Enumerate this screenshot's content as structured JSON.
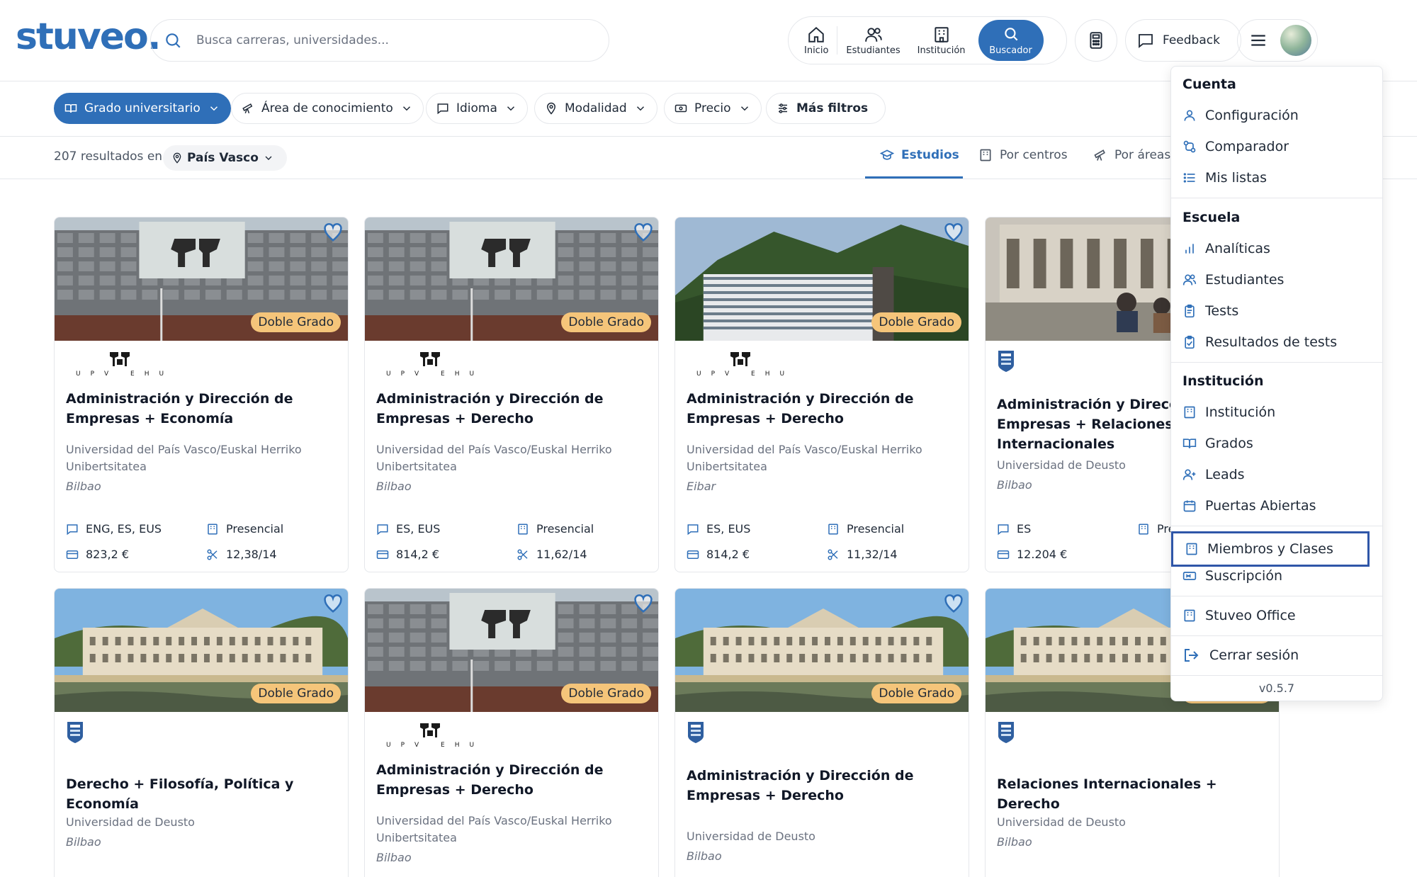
{
  "header": {
    "logo": "stuveo.",
    "search_placeholder": "Busca carreras, universidades...",
    "nav": [
      {
        "label": "Inicio",
        "icon": "home-icon"
      },
      {
        "label": "Estudiantes",
        "icon": "users-icon"
      },
      {
        "label": "Institución",
        "icon": "building-icon"
      },
      {
        "label": "Buscador",
        "icon": "search-icon"
      }
    ],
    "feedback_label": "Feedback"
  },
  "filters": [
    {
      "label": "Grado universitario"
    },
    {
      "label": "Área de conocimiento"
    },
    {
      "label": "Idioma"
    },
    {
      "label": "Modalidad"
    },
    {
      "label": "Precio"
    },
    {
      "label": "Más filtros"
    }
  ],
  "results": {
    "count_text": "207 resultados en",
    "region": "País Vasco",
    "tabs": [
      "Estudios",
      "Por centros",
      "Por áreas"
    ]
  },
  "badge_text": "Doble Grado",
  "cards": [
    {
      "title": "Administración y Dirección de Empresas + Economía",
      "university": "Universidad del País Vasco/Euskal Herriko Unibertsitatea",
      "city": "Bilbao",
      "languages": "ENG, ES, EUS",
      "mode": "Presencial",
      "price": "823,2 €",
      "grade": "12,38/14",
      "logo": "UPV EHU"
    },
    {
      "title": "Administración y Dirección de Empresas + Derecho",
      "university": "Universidad del País Vasco/Euskal Herriko Unibertsitatea",
      "city": "Bilbao",
      "languages": "ES, EUS",
      "mode": "Presencial",
      "price": "814,2 €",
      "grade": "11,62/14",
      "logo": "UPV EHU"
    },
    {
      "title": "Administración y Dirección de Empresas + Derecho",
      "university": "Universidad del País Vasco/Euskal Herriko Unibertsitatea",
      "city": "Eibar",
      "languages": "ES, EUS",
      "mode": "Presencial",
      "price": "814,2 €",
      "grade": "11,32/14",
      "logo": "UPV EHU"
    },
    {
      "title": "Administración y Dirección de Empresas + Relaciones Internacionales",
      "university": "Universidad de Deusto",
      "city": "Bilbao",
      "languages": "ES",
      "mode": "Presencial",
      "price": "12.204 €",
      "grade": "",
      "logo": "Deusto"
    },
    {
      "title": "Derecho + Filosofía, Política y Economía",
      "university": "Universidad de Deusto",
      "city": "Bilbao",
      "logo": "Deusto"
    },
    {
      "title": "Administración y Dirección de Empresas + Derecho",
      "university": "Universidad del País Vasco/Euskal Herriko Unibertsitatea",
      "city": "Bilbao",
      "logo": "UPV EHU"
    },
    {
      "title": "Administración y Dirección de Empresas + Derecho",
      "university": "Universidad de Deusto",
      "city": "Bilbao",
      "logo": "Deusto"
    },
    {
      "title": "Relaciones Internacionales + Derecho",
      "university": "Universidad de Deusto",
      "city": "Bilbao",
      "logo": "Deusto"
    }
  ],
  "menu": {
    "sections": {
      "account": "Cuenta",
      "school": "Escuela",
      "institution": "Institución"
    },
    "items": {
      "configuracion": "Configuración",
      "comparador": "Comparador",
      "mis_listas": "Mis listas",
      "analiticas": "Analíticas",
      "estudiantes": "Estudiantes",
      "tests": "Tests",
      "resultados": "Resultados de tests",
      "institucion": "Institución",
      "grados": "Grados",
      "leads": "Leads",
      "puertas": "Puertas Abiertas",
      "miembros": "Miembros y Clases",
      "suscripcion": "Suscripción",
      "office": "Stuveo Office",
      "logout": "Cerrar sesión"
    },
    "version": "v0.5.7"
  },
  "colors": {
    "brand": "#2f6fb8",
    "badge": "#f5c57a",
    "focus": "#2f56a8"
  }
}
